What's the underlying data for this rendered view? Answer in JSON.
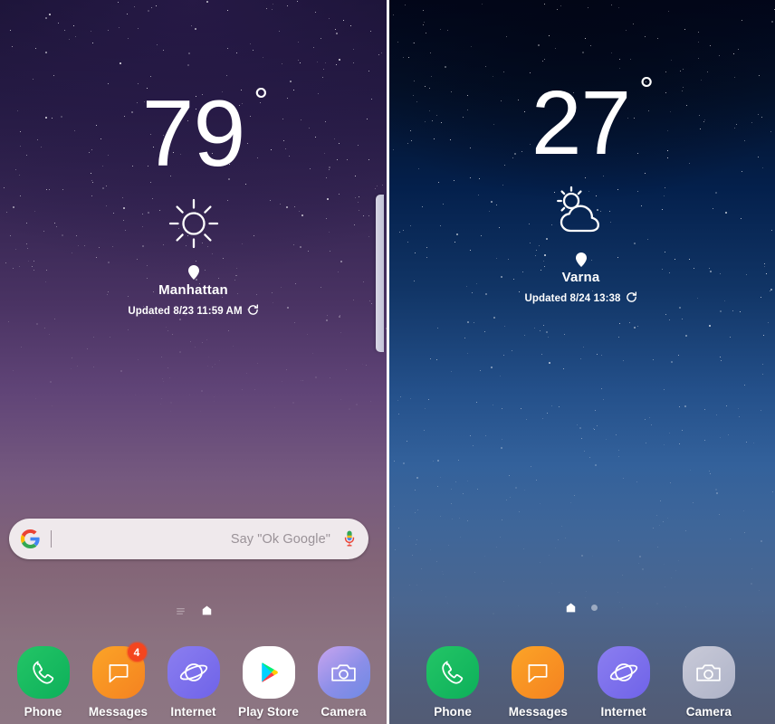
{
  "meta": {
    "description": "Two Samsung Galaxy home screen panels side by side"
  },
  "left_phone": {
    "name": "left-home-screen",
    "wallpaper": {
      "top_color": "#181233",
      "mid_color": "#604477",
      "bottom_color": "#8d7683"
    },
    "weather": {
      "temperature": "79",
      "degree_symbol": "°",
      "condition_icon": "sun-icon",
      "location_pin_icon": "location-pin-icon",
      "city": "Manhattan",
      "updated_text": "Updated 8/23 11:59 AM",
      "refresh_icon": "refresh-icon"
    },
    "search": {
      "logo_icon": "google-g-icon",
      "value": "",
      "placeholder": "Say \"Ok Google\"",
      "mic_icon": "microphone-icon"
    },
    "page_indicator": {
      "icons": [
        "bixby-lines-icon",
        "home-page-icon"
      ],
      "active_index": 1
    },
    "dock": {
      "apps": [
        {
          "label": "Phone",
          "icon": "phone-icon",
          "badge": null
        },
        {
          "label": "Messages",
          "icon": "messages-icon",
          "badge": "4"
        },
        {
          "label": "Internet",
          "icon": "internet-icon",
          "badge": null
        },
        {
          "label": "Play Store",
          "icon": "play-store-icon",
          "badge": null
        },
        {
          "label": "Camera",
          "icon": "camera-icon",
          "badge": null
        }
      ]
    },
    "edge_panel_handle": "edge-panel-handle"
  },
  "right_phone": {
    "name": "right-home-screen",
    "wallpaper": {
      "top_color": "#02061a",
      "mid_color": "#24508a",
      "bottom_color": "#525b74"
    },
    "weather": {
      "temperature": "27",
      "degree_symbol": "°",
      "condition_icon": "sun-behind-cloud-icon",
      "location_pin_icon": "location-pin-icon",
      "city": "Varna",
      "updated_text": "Updated 8/24 13:38",
      "refresh_icon": "refresh-icon"
    },
    "page_indicator": {
      "icons": [
        "home-page-icon",
        "page-dot"
      ],
      "active_index": 0
    },
    "dock": {
      "apps": [
        {
          "label": "Phone",
          "icon": "phone-icon",
          "badge": null
        },
        {
          "label": "Messages",
          "icon": "messages-icon",
          "badge": null
        },
        {
          "label": "Internet",
          "icon": "internet-icon",
          "badge": null
        },
        {
          "label": "Camera",
          "icon": "camera-icon",
          "badge": null
        }
      ]
    }
  },
  "colors": {
    "badge_red": "#f4461f",
    "phone_green": "#0db05a",
    "messages_orange": "#f58220",
    "internet_purple": "#6f63e8",
    "search_bar_bg": "#efe9ec"
  }
}
